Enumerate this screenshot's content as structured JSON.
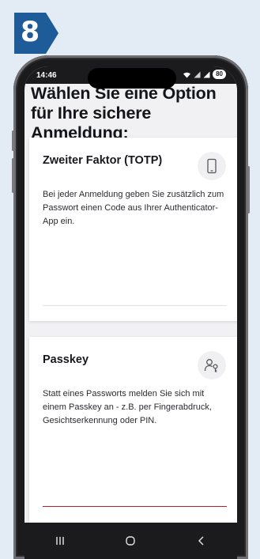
{
  "step": {
    "number": "8",
    "badge_color": "#1e5b99"
  },
  "status_bar": {
    "time": "14:46",
    "battery": "80"
  },
  "page": {
    "title": "Wählen Sie eine Option für Ihre sichere Anmeldung:"
  },
  "options": [
    {
      "title": "Zweiter Faktor (TOTP)",
      "description": "Bei jeder Anmeldung geben Sie zusätzlich zum Passwort einen Code aus Ihrer Authenticator-App ein.",
      "icon": "smartphone-icon"
    },
    {
      "title": "Passkey",
      "description": "Statt eines Passworts melden Sie sich mit einem Passkey an - z.B. per Fingerabdruck, Gesichtserkennung oder PIN.",
      "icon": "passkey-icon",
      "accent_color": "#c8162b"
    }
  ],
  "navigation": {
    "recent": "recent-apps-icon",
    "home": "home-icon",
    "back": "back-icon"
  }
}
